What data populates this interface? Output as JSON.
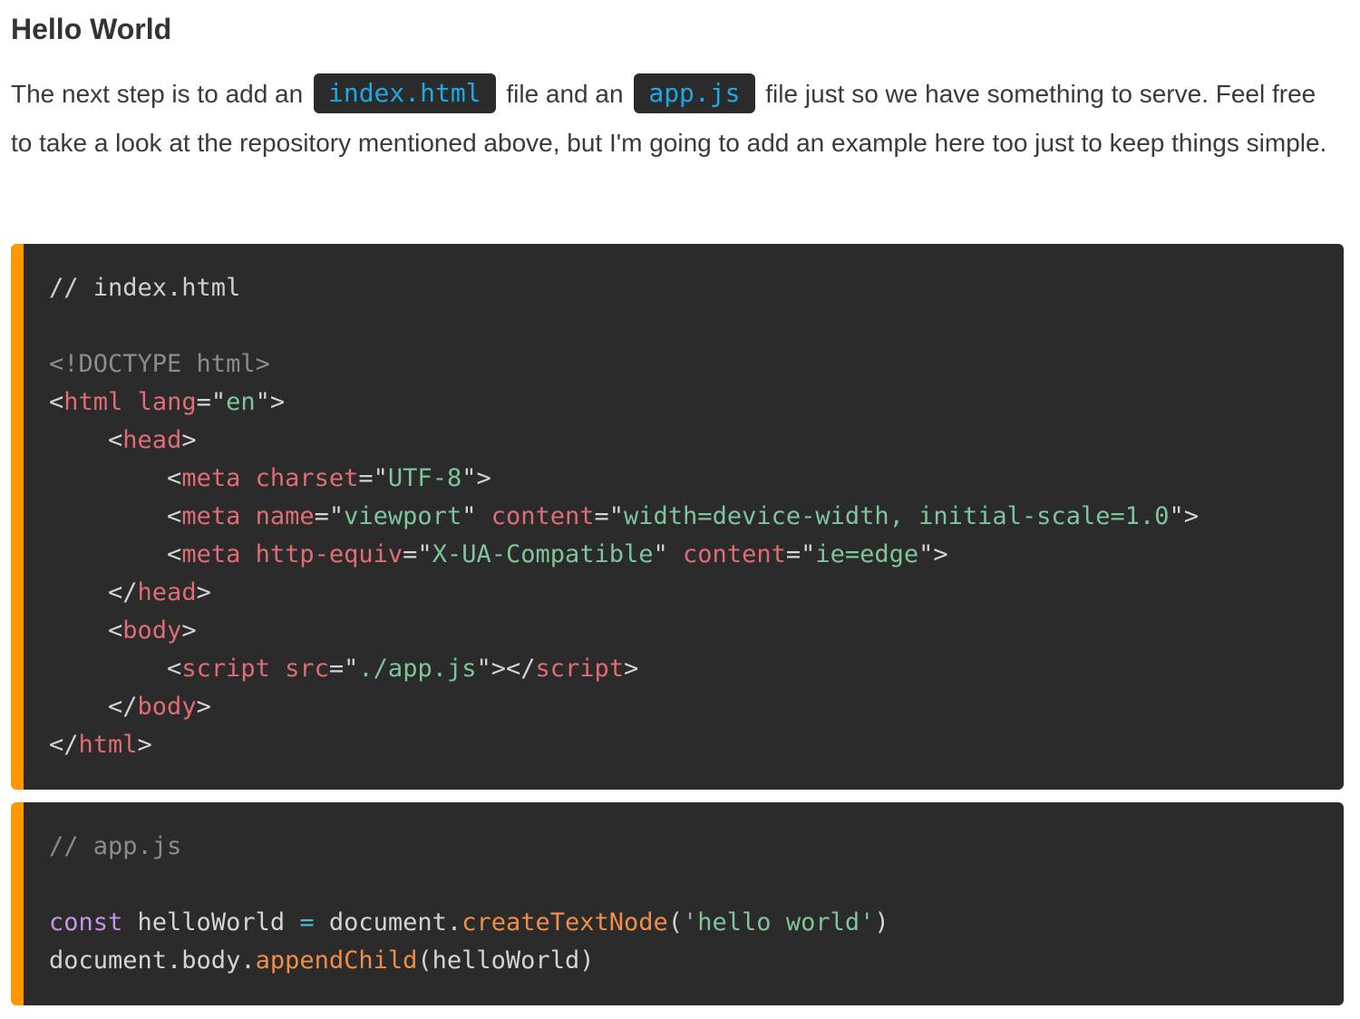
{
  "heading": "Hello World",
  "paragraph": {
    "before_code1": "The next step is to add an ",
    "code1": "index.html",
    "between": " file and an ",
    "code2": "app.js",
    "after_code2": " file just so we have something to serve. Feel free to take a look at the repository mentioned above, but I'm going to add an example here too just to keep things simple."
  },
  "code_blocks": [
    {
      "lines": [
        [
          {
            "t": "comment",
            "v": "// index.html"
          }
        ],
        [],
        [
          {
            "t": "doctype",
            "v": "<!DOCTYPE html>"
          }
        ],
        [
          {
            "t": "punct",
            "v": "<"
          },
          {
            "t": "tag",
            "v": "html"
          },
          {
            "t": "plain",
            "v": " "
          },
          {
            "t": "attr",
            "v": "lang"
          },
          {
            "t": "punct",
            "v": "=\""
          },
          {
            "t": "str",
            "v": "en"
          },
          {
            "t": "punct",
            "v": "\">"
          }
        ],
        [
          {
            "t": "plain",
            "v": "    "
          },
          {
            "t": "punct",
            "v": "<"
          },
          {
            "t": "tag",
            "v": "head"
          },
          {
            "t": "punct",
            "v": ">"
          }
        ],
        [
          {
            "t": "plain",
            "v": "        "
          },
          {
            "t": "punct",
            "v": "<"
          },
          {
            "t": "tag",
            "v": "meta"
          },
          {
            "t": "plain",
            "v": " "
          },
          {
            "t": "attr",
            "v": "charset"
          },
          {
            "t": "punct",
            "v": "=\""
          },
          {
            "t": "str",
            "v": "UTF-8"
          },
          {
            "t": "punct",
            "v": "\">"
          }
        ],
        [
          {
            "t": "plain",
            "v": "        "
          },
          {
            "t": "punct",
            "v": "<"
          },
          {
            "t": "tag",
            "v": "meta"
          },
          {
            "t": "plain",
            "v": " "
          },
          {
            "t": "attr",
            "v": "name"
          },
          {
            "t": "punct",
            "v": "=\""
          },
          {
            "t": "str",
            "v": "viewport"
          },
          {
            "t": "punct",
            "v": "\" "
          },
          {
            "t": "attr",
            "v": "content"
          },
          {
            "t": "punct",
            "v": "=\""
          },
          {
            "t": "str",
            "v": "width=device-width, initial-scale=1.0"
          },
          {
            "t": "punct",
            "v": "\">"
          }
        ],
        [
          {
            "t": "plain",
            "v": "        "
          },
          {
            "t": "punct",
            "v": "<"
          },
          {
            "t": "tag",
            "v": "meta"
          },
          {
            "t": "plain",
            "v": " "
          },
          {
            "t": "attr",
            "v": "http-equiv"
          },
          {
            "t": "punct",
            "v": "=\""
          },
          {
            "t": "str",
            "v": "X-UA-Compatible"
          },
          {
            "t": "punct",
            "v": "\" "
          },
          {
            "t": "attr",
            "v": "content"
          },
          {
            "t": "punct",
            "v": "=\""
          },
          {
            "t": "str",
            "v": "ie=edge"
          },
          {
            "t": "punct",
            "v": "\">"
          }
        ],
        [
          {
            "t": "plain",
            "v": "    "
          },
          {
            "t": "punct",
            "v": "</"
          },
          {
            "t": "tag",
            "v": "head"
          },
          {
            "t": "punct",
            "v": ">"
          }
        ],
        [
          {
            "t": "plain",
            "v": "    "
          },
          {
            "t": "punct",
            "v": "<"
          },
          {
            "t": "tag",
            "v": "body"
          },
          {
            "t": "punct",
            "v": ">"
          }
        ],
        [
          {
            "t": "plain",
            "v": "        "
          },
          {
            "t": "punct",
            "v": "<"
          },
          {
            "t": "tag",
            "v": "script"
          },
          {
            "t": "plain",
            "v": " "
          },
          {
            "t": "attr",
            "v": "src"
          },
          {
            "t": "punct",
            "v": "=\""
          },
          {
            "t": "str",
            "v": "./app.js"
          },
          {
            "t": "punct",
            "v": "\"></"
          },
          {
            "t": "tag",
            "v": "script"
          },
          {
            "t": "punct",
            "v": ">"
          }
        ],
        [
          {
            "t": "plain",
            "v": "    "
          },
          {
            "t": "punct",
            "v": "</"
          },
          {
            "t": "tag",
            "v": "body"
          },
          {
            "t": "punct",
            "v": ">"
          }
        ],
        [
          {
            "t": "punct",
            "v": "</"
          },
          {
            "t": "tag",
            "v": "html"
          },
          {
            "t": "punct",
            "v": ">"
          }
        ]
      ]
    },
    {
      "lines": [
        [
          {
            "t": "comment-dim",
            "v": "// app.js"
          }
        ],
        [],
        [
          {
            "t": "keyword",
            "v": "const"
          },
          {
            "t": "plain",
            "v": " helloWorld "
          },
          {
            "t": "op",
            "v": "="
          },
          {
            "t": "plain",
            "v": " document."
          },
          {
            "t": "func",
            "v": "createTextNode"
          },
          {
            "t": "plain",
            "v": "("
          },
          {
            "t": "str",
            "v": "'hello world'"
          },
          {
            "t": "plain",
            "v": ")"
          }
        ],
        [
          {
            "t": "plain",
            "v": "document.body."
          },
          {
            "t": "func",
            "v": "appendChild"
          },
          {
            "t": "plain",
            "v": "(helloWorld)"
          }
        ]
      ]
    }
  ],
  "colors": {
    "accent_bar": "#ff9800",
    "code_bg": "#2b2b2b",
    "inline_code_text": "#1fa7e6",
    "tag": "#e06c75",
    "string": "#7ec699",
    "keyword": "#c792ea",
    "function": "#f08d49"
  }
}
